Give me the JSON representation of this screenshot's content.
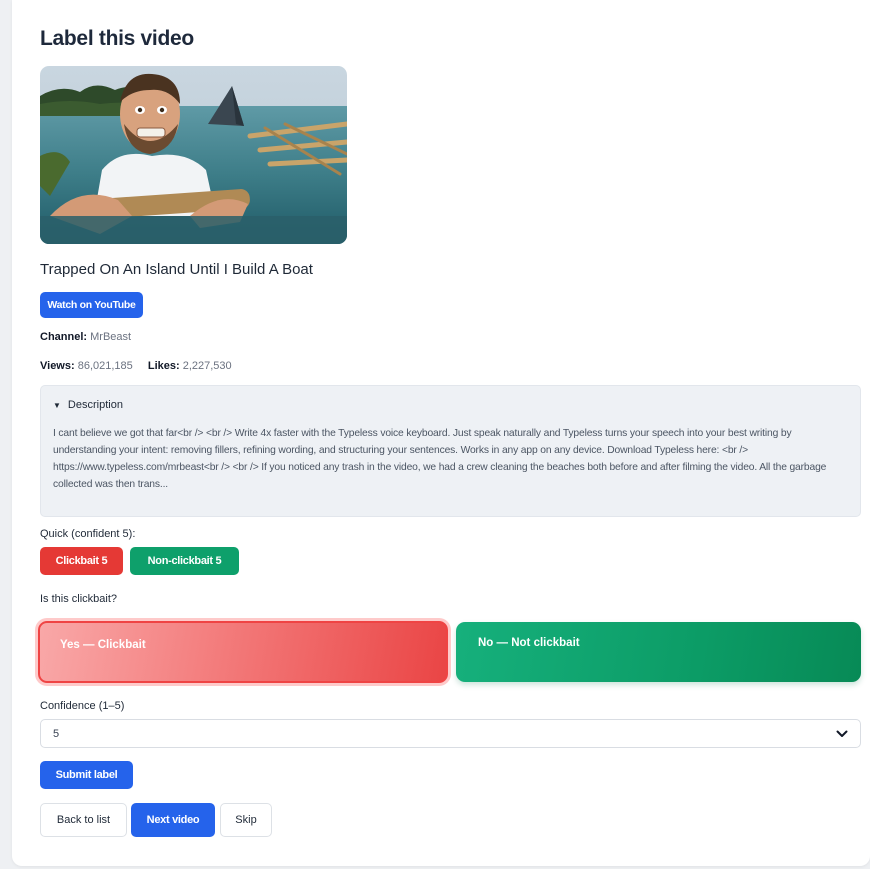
{
  "page": {
    "title": "Label this video"
  },
  "video": {
    "title": "Trapped On An Island Until I Build A Boat",
    "watch_label": "Watch on YouTube",
    "channel_label": "Channel:",
    "channel": "MrBeast",
    "views_label": "Views:",
    "views": "86,021,185",
    "likes_label": "Likes:",
    "likes": "2,227,530"
  },
  "description": {
    "summary": "Description",
    "text": "I cant believe we got that far<br /> <br /> Write 4x faster with the Typeless voice keyboard. Just speak naturally and Typeless turns your speech into your best writing by understanding your intent: removing fillers, refining wording, and structuring your sentences. Works in any app on any device. Download Typeless here: <br /> https://www.typeless.com/mrbeast<br /> <br /> If you noticed any trash in the video, we had a crew cleaning the beaches both before and after filming the video. All the garbage collected was then trans..."
  },
  "quick": {
    "label": "Quick (confident 5):",
    "clickbait": "Clickbait 5",
    "non_clickbait": "Non-clickbait 5"
  },
  "question": {
    "label": "Is this clickbait?",
    "yes": "Yes — Clickbait",
    "no": "No — Not clickbait",
    "selected": "yes"
  },
  "confidence": {
    "label": "Confidence (1–5)",
    "value": "5"
  },
  "actions": {
    "submit": "Submit label",
    "back": "Back to list",
    "next": "Next video",
    "skip": "Skip"
  },
  "colors": {
    "primary": "#2563eb",
    "red": "#e53935",
    "green": "#0ea06b"
  }
}
